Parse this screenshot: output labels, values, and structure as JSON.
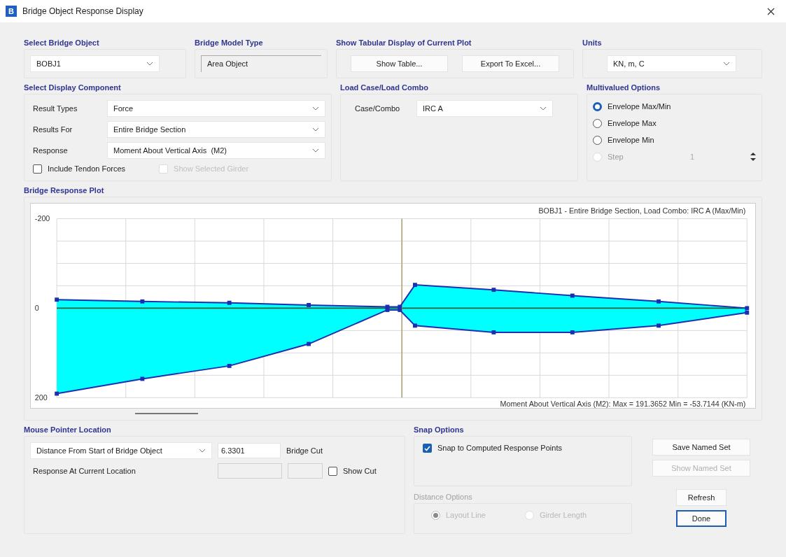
{
  "window": {
    "title": "Bridge Object Response Display",
    "app_icon": "B"
  },
  "select_bridge_object": {
    "heading": "Select Bridge Object",
    "value": "BOBJ1"
  },
  "bridge_model_type": {
    "heading": "Bridge Model Type",
    "value": "Area Object"
  },
  "tabular": {
    "heading": "Show Tabular Display of Current Plot",
    "buttons": [
      "Show Table...",
      "Export To Excel..."
    ]
  },
  "units": {
    "heading": "Units",
    "value": "KN, m, C"
  },
  "display_component": {
    "heading": "Select Display Component",
    "rows": [
      {
        "label": "Result Types",
        "value": "Force"
      },
      {
        "label": "Results For",
        "value": "Entire Bridge Section"
      },
      {
        "label": "Response",
        "value": "Moment About Vertical Axis  (M2)"
      }
    ],
    "checkboxes": [
      {
        "label": "Include Tendon Forces",
        "checked": false,
        "disabled": false
      },
      {
        "label": "Show Selected Girder",
        "checked": false,
        "disabled": true
      }
    ]
  },
  "load_case": {
    "heading": "Load Case/Load Combo",
    "label": "Case/Combo",
    "value": "IRC A"
  },
  "multivalued": {
    "heading": "Multivalued Options",
    "options": [
      {
        "label": "Envelope Max/Min",
        "selected": true,
        "disabled": false
      },
      {
        "label": "Envelope Max",
        "selected": false,
        "disabled": false
      },
      {
        "label": "Envelope Min",
        "selected": false,
        "disabled": false
      },
      {
        "label": "Step",
        "selected": false,
        "disabled": true
      }
    ],
    "step_value": "1"
  },
  "plot": {
    "heading": "Bridge Response Plot",
    "title": "BOBJ1 - Entire Bridge Section,  Load Combo: IRC A (Max/Min)",
    "footer": "Moment About Vertical Axis  (M2):  Max = 191.3652    Min = -53.7144  (KN-m)",
    "axis_labels": [
      "-200",
      "0",
      "200"
    ]
  },
  "mouse_pointer": {
    "heading": "Mouse Pointer Location",
    "distance_option": "Distance From Start of Bridge Object",
    "distance_value": "6.3301",
    "bridge_cut_label": "Bridge Cut",
    "response_label": "Response At Current Location",
    "show_cut": {
      "label": "Show Cut",
      "checked": false
    }
  },
  "snap": {
    "heading": "Snap Options",
    "checkbox": {
      "label": "Snap to Computed Response Points",
      "checked": true
    }
  },
  "distance_options": {
    "heading": "Distance Options",
    "disabled": true,
    "options": [
      {
        "label": "Layout Line",
        "selected": true
      },
      {
        "label": "Girder Length",
        "selected": false
      }
    ]
  },
  "side_buttons": [
    {
      "label": "Save Named Set",
      "disabled": false,
      "default": false
    },
    {
      "label": "Show Named Set",
      "disabled": true,
      "default": false
    },
    {
      "label": "Refresh",
      "disabled": false,
      "default": false
    },
    {
      "label": "Done",
      "disabled": false,
      "default": true
    }
  ]
}
